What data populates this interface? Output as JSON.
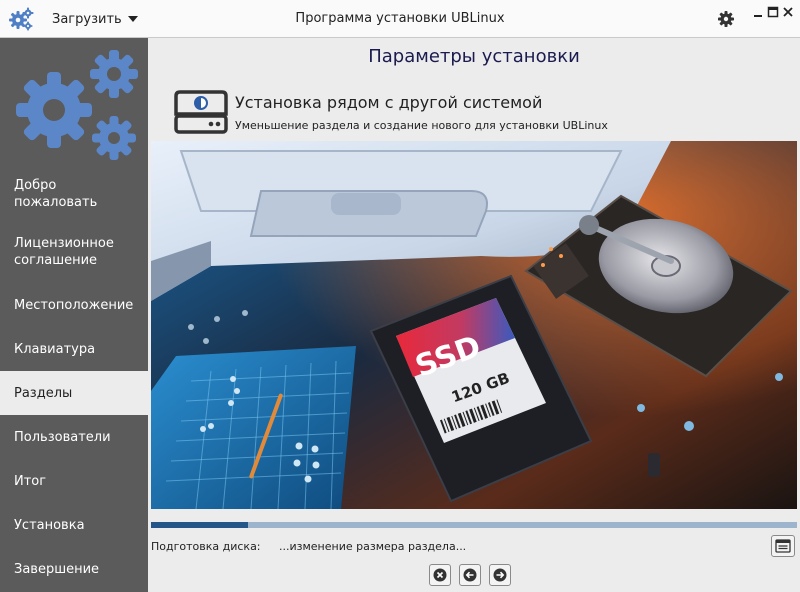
{
  "titlebar": {
    "menu_label": "Загрузить",
    "window_title": "Программа установки UBLinux"
  },
  "sidebar": {
    "items": [
      {
        "label": "Добро пожаловать",
        "active": false
      },
      {
        "label": "Лицензионное соглашение",
        "active": false
      },
      {
        "label": "Местоположение",
        "active": false
      },
      {
        "label": "Клавиатура",
        "active": false
      },
      {
        "label": "Разделы",
        "active": true
      },
      {
        "label": "Пользователи",
        "active": false
      },
      {
        "label": "Итог",
        "active": false
      },
      {
        "label": "Установка",
        "active": false
      },
      {
        "label": "Завершение",
        "active": false
      }
    ]
  },
  "main": {
    "page_title": "Параметры установки",
    "install_title": "Установка рядом с другой системой",
    "install_subtitle": "Уменьшение раздела и создание нового для установки UBLinux",
    "hero": {
      "ssd_label": "SSD",
      "ssd_capacity": "120 GB"
    },
    "progress_fraction": 0.15,
    "status_label": "Подготовка диска:",
    "status_text": "...изменение размера раздела..."
  },
  "colors": {
    "sidebar_bg": "#5b5b5b",
    "logo_blue": "#5b87c9",
    "progress_fill": "#24568a",
    "progress_track": "#9cb4cc",
    "page_title": "#1b1b4f"
  },
  "icons": {
    "app": "gears-icon",
    "settings": "gear-icon",
    "disk": "hard-drive-icon",
    "log": "log-icon",
    "cancel": "cancel-icon",
    "back": "arrow-left-icon",
    "next": "arrow-right-icon"
  }
}
